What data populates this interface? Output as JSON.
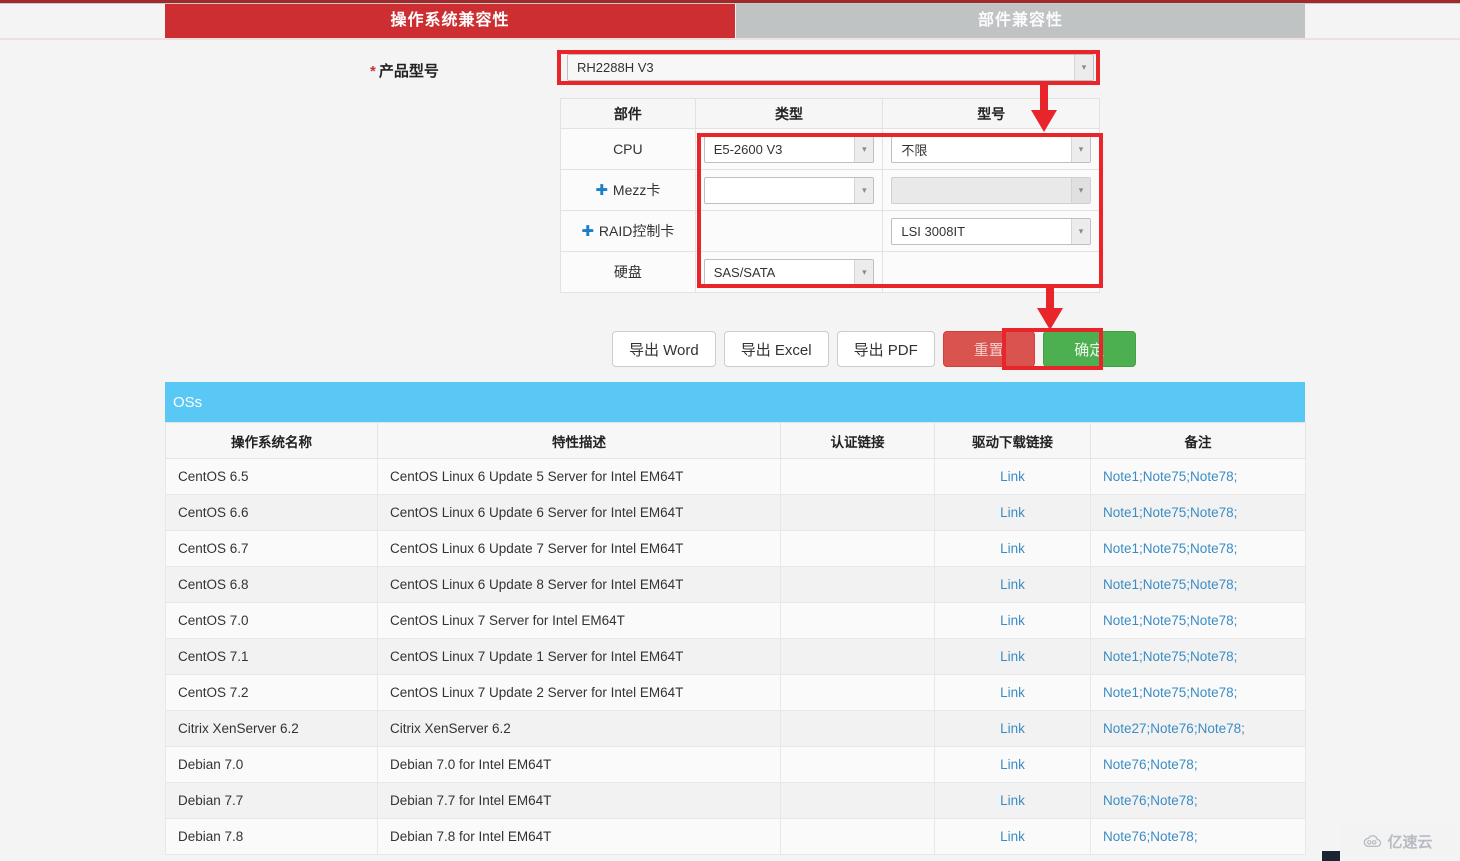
{
  "tabs": [
    {
      "label": "操作系统兼容性",
      "active": true
    },
    {
      "label": "部件兼容性",
      "active": false
    }
  ],
  "form": {
    "required_mark": "*",
    "model_label": "产品型号",
    "model_value": "RH2288H V3",
    "dropdown_arrow": "chevron-down-icon"
  },
  "component_table": {
    "headers": [
      "部件",
      "类型",
      "型号"
    ],
    "rows": [
      {
        "part": "CPU",
        "has_plus": false,
        "type_value": "E5-2600 V3",
        "type_enabled": true,
        "model_value": "不限",
        "model_enabled": true
      },
      {
        "part": "Mezz卡",
        "has_plus": true,
        "type_value": "",
        "type_enabled": true,
        "model_value": "",
        "model_enabled": false
      },
      {
        "part": "RAID控制卡",
        "has_plus": true,
        "type_value": null,
        "type_enabled": false,
        "model_value": "LSI 3008IT",
        "model_enabled": true
      },
      {
        "part": "硬盘",
        "has_plus": false,
        "type_value": "SAS/SATA",
        "type_enabled": true,
        "model_value": null,
        "model_enabled": false
      }
    ]
  },
  "buttons": [
    {
      "label": "导出 Word",
      "style": "default"
    },
    {
      "label": "导出 Excel",
      "style": "default"
    },
    {
      "label": "导出 PDF",
      "style": "default"
    },
    {
      "label": "重置",
      "style": "reset"
    },
    {
      "label": "确定",
      "style": "ok"
    }
  ],
  "oss": {
    "panel_title": "OSs",
    "headers": [
      "操作系统名称",
      "特性描述",
      "认证链接",
      "驱动下载链接",
      "备注"
    ],
    "rows": [
      {
        "os": "CentOS 6.5",
        "desc": "CentOS Linux 6 Update 5 Server for Intel EM64T",
        "cert": "",
        "driver": "Link",
        "note": "Note1;Note75;Note78;"
      },
      {
        "os": "CentOS 6.6",
        "desc": "CentOS Linux 6 Update 6 Server for Intel EM64T",
        "cert": "",
        "driver": "Link",
        "note": "Note1;Note75;Note78;"
      },
      {
        "os": "CentOS 6.7",
        "desc": "CentOS Linux 6 Update 7 Server for Intel EM64T",
        "cert": "",
        "driver": "Link",
        "note": "Note1;Note75;Note78;"
      },
      {
        "os": "CentOS 6.8",
        "desc": "CentOS Linux 6 Update 8 Server for Intel EM64T",
        "cert": "",
        "driver": "Link",
        "note": "Note1;Note75;Note78;"
      },
      {
        "os": "CentOS 7.0",
        "desc": "CentOS Linux 7 Server for Intel EM64T",
        "cert": "",
        "driver": "Link",
        "note": "Note1;Note75;Note78;"
      },
      {
        "os": "CentOS 7.1",
        "desc": "CentOS Linux 7 Update 1 Server for Intel EM64T",
        "cert": "",
        "driver": "Link",
        "note": "Note1;Note75;Note78;"
      },
      {
        "os": "CentOS 7.2",
        "desc": "CentOS Linux 7 Update 2 Server for Intel EM64T",
        "cert": "",
        "driver": "Link",
        "note": "Note1;Note75;Note78;"
      },
      {
        "os": "Citrix XenServer 6.2",
        "desc": "Citrix XenServer 6.2",
        "cert": "",
        "driver": "Link",
        "note": "Note27;Note76;Note78;"
      },
      {
        "os": "Debian 7.0",
        "desc": "Debian 7.0 for Intel EM64T",
        "cert": "",
        "driver": "Link",
        "note": "Note76;Note78;"
      },
      {
        "os": "Debian 7.7",
        "desc": "Debian 7.7 for Intel EM64T",
        "cert": "",
        "driver": "Link",
        "note": "Note76;Note78;"
      },
      {
        "os": "Debian 7.8",
        "desc": "Debian 7.8 for Intel EM64T",
        "cert": "",
        "driver": "Link",
        "note": "Note76;Note78;"
      }
    ]
  },
  "watermark": {
    "text": "亿速云",
    "icon": "cloud-icon"
  },
  "colors": {
    "tab_active": "#cc2e31",
    "tab_inactive": "#bfc3c4",
    "annotation": "#e8252a",
    "panel_header": "#5ac8f5",
    "link": "#3b8cc4",
    "reset_button": "#d9534f",
    "ok_button": "#4caf50",
    "plus_icon": "#1a7ec8"
  }
}
